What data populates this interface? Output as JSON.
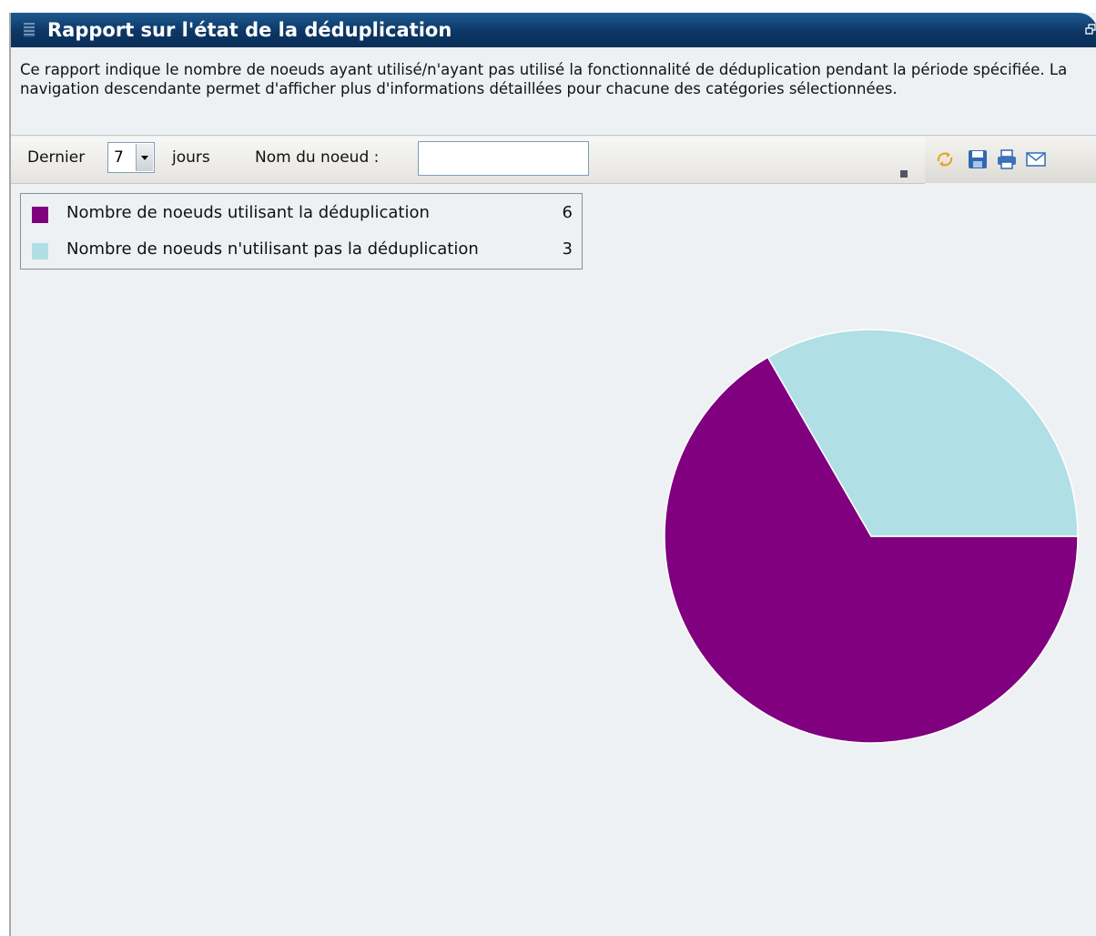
{
  "window": {
    "title": "Rapport sur l'état de la déduplication",
    "restore_icon": "restore-window-icon"
  },
  "description": "Ce rapport indique le nombre de noeuds ayant utilisé/n'ayant pas utilisé la fonctionnalité de déduplication pendant la période spécifiée. La navigation descendante permet d'afficher plus d'informations détaillées pour chacune des catégories sélectionnées.",
  "toolbar": {
    "last_label": "Dernier",
    "days_value": "7",
    "days_label": "jours",
    "node_label": "Nom du noeud :",
    "node_value": "",
    "icons": [
      "refresh-icon",
      "save-icon",
      "print-icon",
      "email-icon"
    ]
  },
  "colors": {
    "with_dedup": "#800080",
    "without_dedup": "#b0dfe5",
    "title_bar": "#0c3665",
    "background": "#eef1f3"
  },
  "chart_data": {
    "type": "pie",
    "title": "",
    "legend_position": "top-left",
    "slices": [
      {
        "label": "Nombre de noeuds utilisant la déduplication",
        "value": 6,
        "color": "#800080"
      },
      {
        "label": "Nombre de noeuds n'utilisant pas la déduplication",
        "value": 3,
        "color": "#b0dfe5"
      }
    ]
  }
}
